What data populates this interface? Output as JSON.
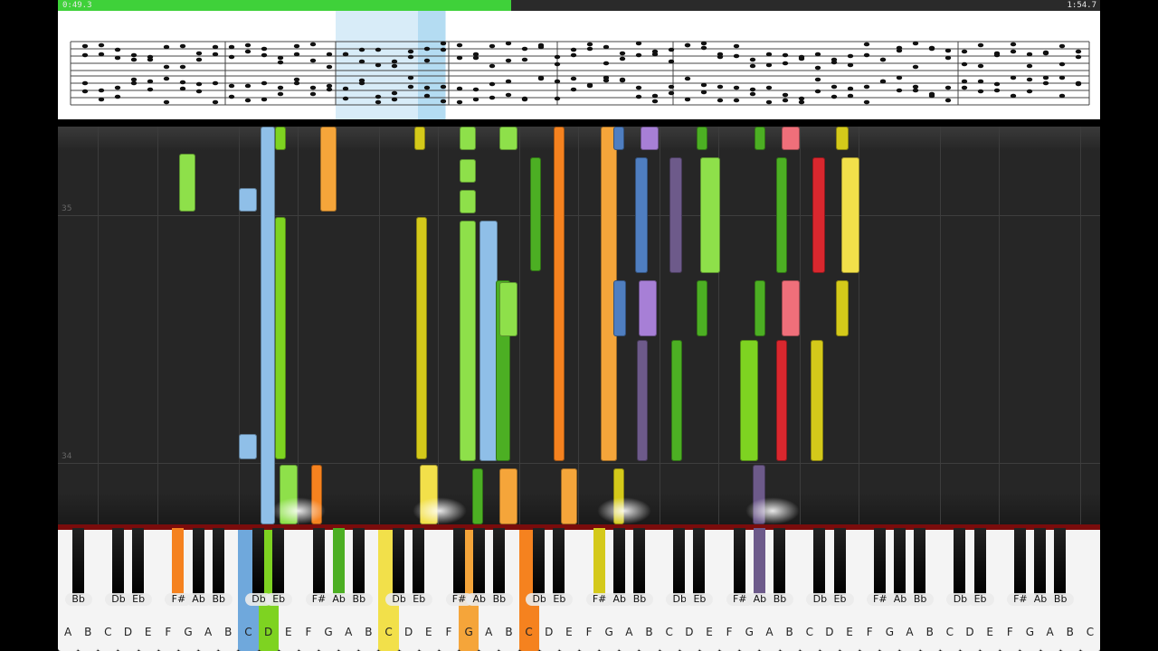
{
  "progress": {
    "elapsed": "0:49.3",
    "total": "1:54.7",
    "fraction": 0.435
  },
  "roll": {
    "measure_upper": "35",
    "measure_lower": "34"
  },
  "keyboard": {
    "white_labels": [
      "A",
      "B",
      "C",
      "D",
      "E",
      "F",
      "G",
      "A",
      "B",
      "C",
      "D",
      "E",
      "F",
      "G",
      "A",
      "B",
      "C",
      "D",
      "E",
      "F",
      "G",
      "A",
      "B",
      "C",
      "D",
      "E",
      "F",
      "G",
      "A",
      "B",
      "C",
      "D",
      "E",
      "F",
      "G",
      "A",
      "B",
      "C",
      "D",
      "E",
      "F",
      "G",
      "A",
      "B",
      "C",
      "D",
      "E",
      "F",
      "G",
      "A",
      "B",
      "C"
    ],
    "black_labels": [
      "Bb",
      "Db",
      "Eb",
      "F#",
      "Ab",
      "Bb",
      "Db",
      "Eb",
      "F#",
      "Ab",
      "Bb",
      "Db",
      "Eb",
      "F#",
      "Ab",
      "Bb",
      "Db",
      "Eb",
      "F#",
      "Ab",
      "Bb",
      "Db",
      "Eb",
      "F#",
      "Ab",
      "Bb",
      "Db",
      "Eb",
      "F#",
      "Ab",
      "Bb",
      "Db",
      "Eb",
      "F#",
      "Ab",
      "Bb"
    ],
    "pressed": [
      {
        "label": "D",
        "color": "#6fa8dc"
      },
      {
        "label": "E",
        "color": "#7ed321"
      },
      {
        "label": "F#",
        "color": "#f5821f"
      },
      {
        "label": "E",
        "color": "#f2e04a"
      },
      {
        "label": "Ab",
        "color": "#4caf23"
      },
      {
        "label": "B",
        "color": "#f5a53a"
      },
      {
        "label": "E",
        "color": "#f5821f"
      },
      {
        "label": "Ab",
        "color": "#d4c91a"
      },
      {
        "label": "Ab",
        "color": "#6d5a8a"
      }
    ]
  },
  "colors": {
    "accent": "#3fd13a",
    "background": "#262626",
    "key_rim": "#7a0c0c"
  }
}
